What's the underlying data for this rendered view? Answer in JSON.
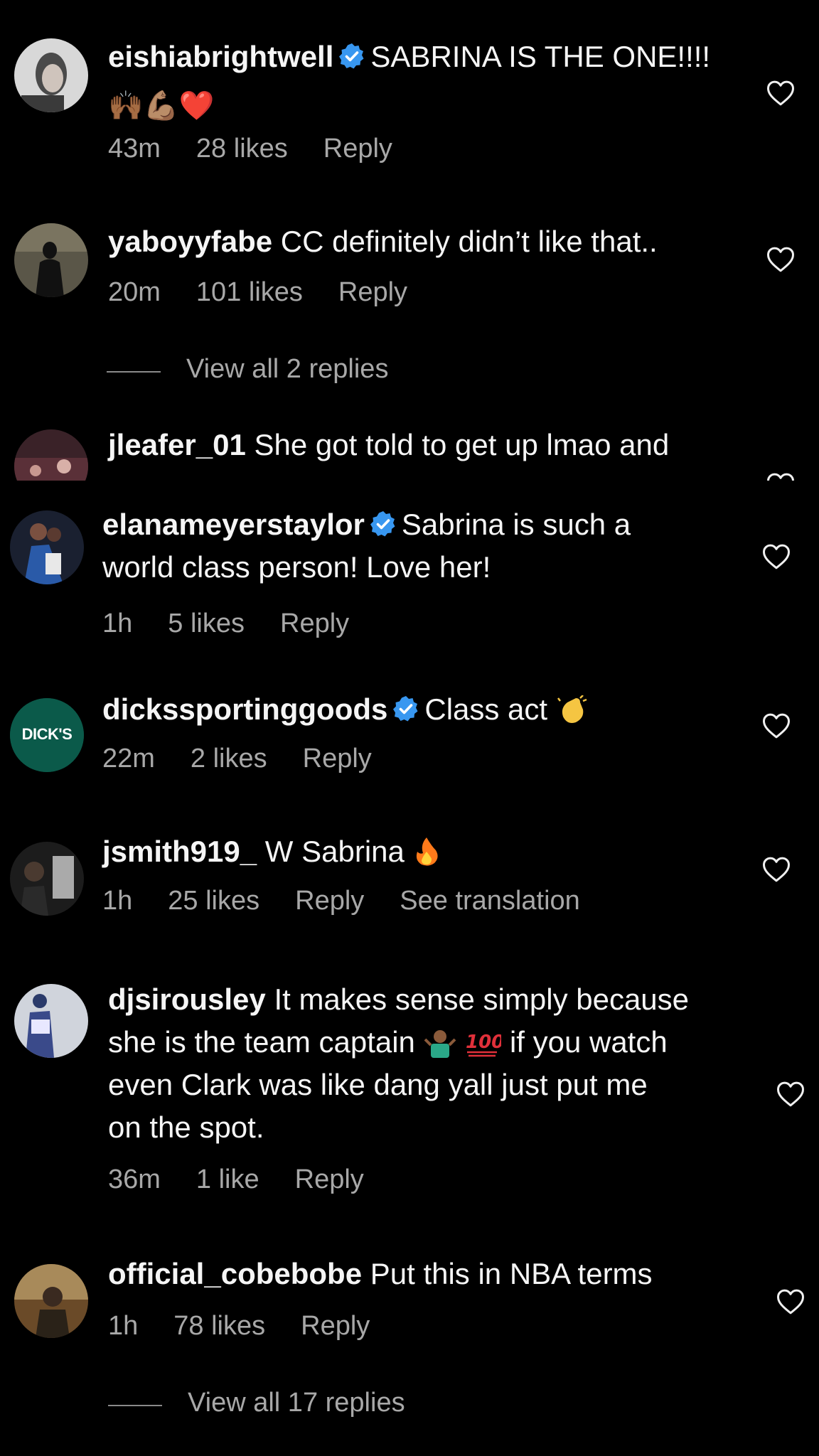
{
  "comments_top": [
    {
      "username": "eishiabrightwell",
      "verified": true,
      "text": "SABRINA IS THE ONE!!!!",
      "emoji_line": "🙌🏾💪🏽❤️",
      "time": "43m",
      "likes": "28 likes",
      "reply": "Reply"
    },
    {
      "username": "yaboyyfabe",
      "verified": false,
      "text": "CC definitely didn’t like that..",
      "time": "20m",
      "likes": "101 likes",
      "reply": "Reply",
      "view_replies": "View all 2 replies"
    },
    {
      "username": "jleafer_01",
      "verified": false,
      "text": "She got told to get up lmao and"
    }
  ],
  "comments_bottom": [
    {
      "username": "elanameyerstaylor",
      "verified": true,
      "text_line1": "Sabrina is such a",
      "text_line2": "world class person! Love her!",
      "time": "1h",
      "likes": "5 likes",
      "reply": "Reply"
    },
    {
      "username": "dickssportinggoods",
      "verified": true,
      "avatar_text": "DICK'S",
      "text": "Class act",
      "time": "22m",
      "likes": "2 likes",
      "reply": "Reply"
    },
    {
      "username": "jsmith919_",
      "verified": false,
      "text": "W Sabrina",
      "time": "1h",
      "likes": "25 likes",
      "reply": "Reply",
      "translate": "See translation"
    },
    {
      "username": "djsirousley",
      "verified": false,
      "text_line1": "It makes sense simply because",
      "text_line2a": "she is the team captain",
      "text_line2b": "if you watch",
      "text_line3": "even Clark was like dang yall just put me",
      "text_line4": "on the spot.",
      "time": "36m",
      "likes": "1 like",
      "reply": "Reply"
    },
    {
      "username": "official_cobebobe",
      "verified": false,
      "text": "Put this in NBA terms",
      "time": "1h",
      "likes": "78 likes",
      "reply": "Reply",
      "view_replies": "View all 17 replies"
    }
  ],
  "colors": {
    "background": "#000000",
    "text": "#f5f5f5",
    "meta": "#a8a8a8",
    "verified": "#3897f0",
    "dicks_green": "#0b5a4a"
  },
  "icons": [
    "heart-outline-icon",
    "verified-badge-icon"
  ]
}
